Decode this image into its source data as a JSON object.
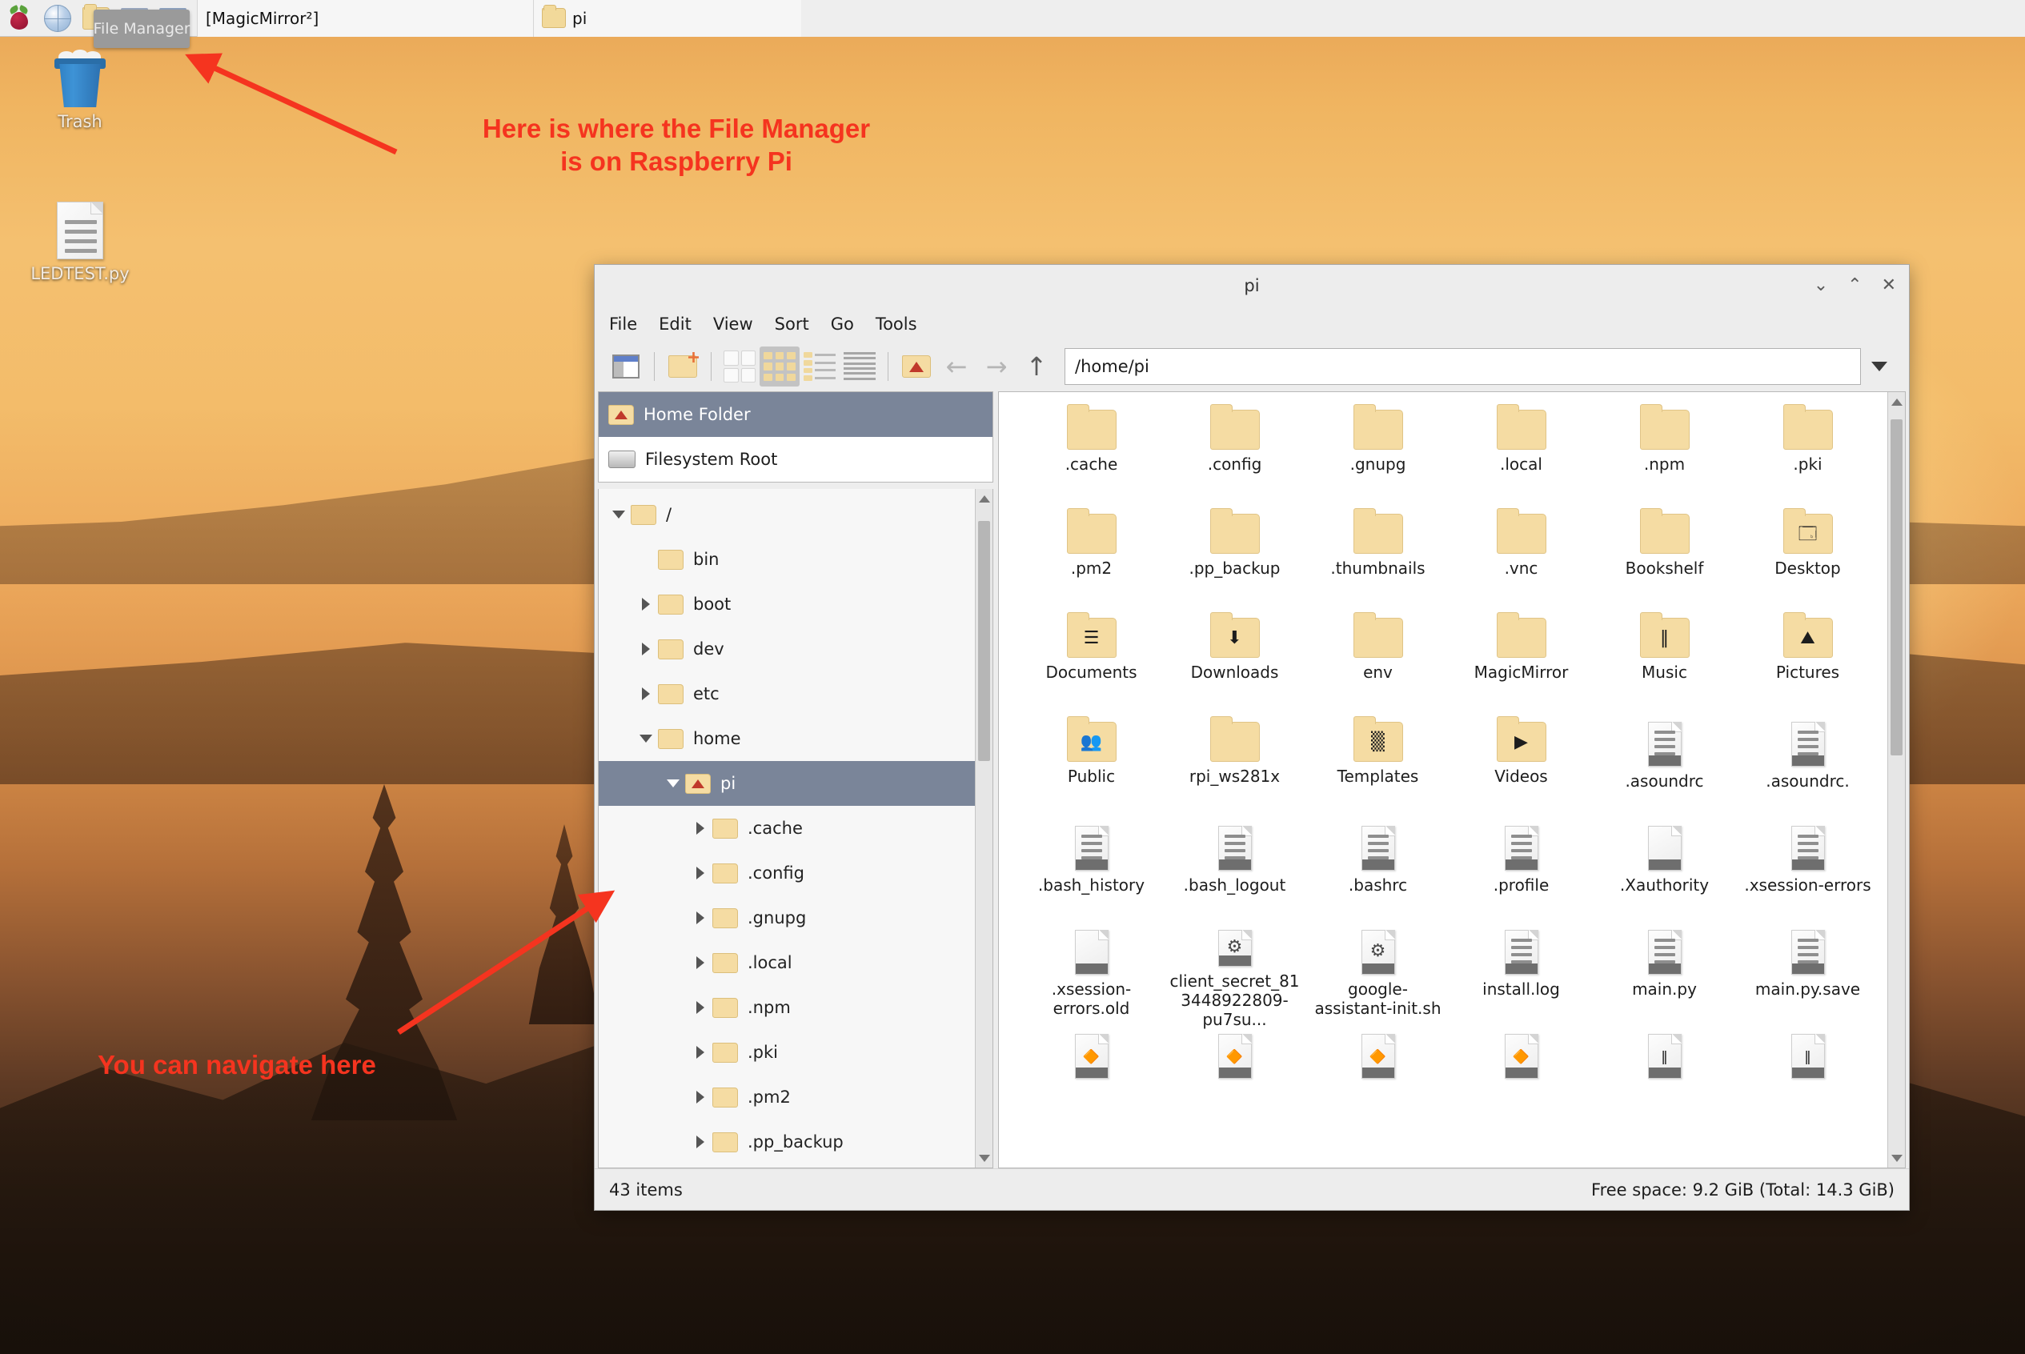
{
  "taskbar": {
    "launchers": [
      {
        "name": "raspberry-menu",
        "icon": "raspberry-icon"
      },
      {
        "name": "web-browser",
        "icon": "globe-icon"
      },
      {
        "name": "file-manager",
        "icon": "folder-icon"
      },
      {
        "name": "terminal",
        "icon": "monitor-icon"
      },
      {
        "name": "mathematica",
        "icon": "monitor-icon"
      }
    ],
    "windows": [
      {
        "label": "[MagicMirror²]",
        "icon": "monitor-icon",
        "active": false
      },
      {
        "label": "pi",
        "icon": "folder-icon",
        "active": false
      }
    ],
    "tooltip": "File Manager"
  },
  "desktop": {
    "icons": [
      {
        "label": "Trash",
        "icon": "trash-icon"
      },
      {
        "label": "LEDTEST.py",
        "icon": "file-icon"
      }
    ],
    "annotations": [
      {
        "id": "anno-file-manager",
        "line1": "Here is where the File Manager",
        "line2": "is on Raspberry Pi",
        "color": "#f5341f"
      },
      {
        "id": "anno-navigate",
        "line1": "You can navigate here",
        "color": "#f5341f"
      }
    ]
  },
  "window": {
    "title": "pi",
    "controls": {
      "minimize": "⌄",
      "maximize": "⌃",
      "close": "✕"
    },
    "menu": [
      "File",
      "Edit",
      "View",
      "Sort",
      "Go",
      "Tools"
    ],
    "toolbar": {
      "new_tab": "new-tab-icon",
      "new_folder": "new-folder-icon",
      "thumbnail_view": "thumbnail-view-icon",
      "icon_view": "icon-view-icon",
      "compact_view": "compact-view-icon",
      "detailed_view": "detailed-list-view-icon",
      "home": "home-folder-icon",
      "back": "back-arrow-icon",
      "forward": "forward-arrow-icon",
      "up": "up-arrow-icon",
      "dropdown": "path-dropdown-icon"
    },
    "path": "/home/pi",
    "places": [
      {
        "label": "Home Folder",
        "icon": "home-folder-icon",
        "selected": true
      },
      {
        "label": "Filesystem Root",
        "icon": "harddisk-icon",
        "selected": false
      }
    ],
    "tree": [
      {
        "label": "/",
        "depth": 0,
        "twisty": "down",
        "icon": "folder-icon",
        "selected": false
      },
      {
        "label": "bin",
        "depth": 1,
        "twisty": "none",
        "icon": "folder-icon",
        "selected": false
      },
      {
        "label": "boot",
        "depth": 1,
        "twisty": "right",
        "icon": "folder-icon",
        "selected": false
      },
      {
        "label": "dev",
        "depth": 1,
        "twisty": "right",
        "icon": "folder-icon",
        "selected": false
      },
      {
        "label": "etc",
        "depth": 1,
        "twisty": "right",
        "icon": "folder-icon",
        "selected": false
      },
      {
        "label": "home",
        "depth": 1,
        "twisty": "down",
        "icon": "folder-icon",
        "selected": false
      },
      {
        "label": "pi",
        "depth": 2,
        "twisty": "down",
        "icon": "home-folder-icon",
        "selected": true
      },
      {
        "label": ".cache",
        "depth": 3,
        "twisty": "right",
        "icon": "folder-icon",
        "selected": false
      },
      {
        "label": ".config",
        "depth": 3,
        "twisty": "right",
        "icon": "folder-icon",
        "selected": false
      },
      {
        "label": ".gnupg",
        "depth": 3,
        "twisty": "right",
        "icon": "folder-icon",
        "selected": false
      },
      {
        "label": ".local",
        "depth": 3,
        "twisty": "right",
        "icon": "folder-icon",
        "selected": false
      },
      {
        "label": ".npm",
        "depth": 3,
        "twisty": "right",
        "icon": "folder-icon",
        "selected": false
      },
      {
        "label": ".pki",
        "depth": 3,
        "twisty": "right",
        "icon": "folder-icon",
        "selected": false
      },
      {
        "label": ".pm2",
        "depth": 3,
        "twisty": "right",
        "icon": "folder-icon",
        "selected": false
      },
      {
        "label": ".pp_backup",
        "depth": 3,
        "twisty": "right",
        "icon": "folder-icon",
        "selected": false
      }
    ],
    "files": [
      {
        "name": ".cache",
        "type": "folder",
        "emblem": ""
      },
      {
        "name": ".config",
        "type": "folder",
        "emblem": ""
      },
      {
        "name": ".gnupg",
        "type": "folder",
        "emblem": ""
      },
      {
        "name": ".local",
        "type": "folder",
        "emblem": ""
      },
      {
        "name": ".npm",
        "type": "folder",
        "emblem": ""
      },
      {
        "name": ".pki",
        "type": "folder",
        "emblem": ""
      },
      {
        "name": ".pm2",
        "type": "folder",
        "emblem": ""
      },
      {
        "name": ".pp_backup",
        "type": "folder",
        "emblem": ""
      },
      {
        "name": ".thumbnails",
        "type": "folder",
        "emblem": ""
      },
      {
        "name": ".vnc",
        "type": "folder",
        "emblem": ""
      },
      {
        "name": "Bookshelf",
        "type": "folder",
        "emblem": ""
      },
      {
        "name": "Desktop",
        "type": "folder",
        "emblem": "🗔"
      },
      {
        "name": "Documents",
        "type": "folder",
        "emblem": "☰"
      },
      {
        "name": "Downloads",
        "type": "folder",
        "emblem": "⬇"
      },
      {
        "name": "env",
        "type": "folder",
        "emblem": ""
      },
      {
        "name": "MagicMirror",
        "type": "folder",
        "emblem": ""
      },
      {
        "name": "Music",
        "type": "folder",
        "emblem": "‖"
      },
      {
        "name": "Pictures",
        "type": "folder",
        "emblem": "⛰"
      },
      {
        "name": "Public",
        "type": "folder",
        "emblem": "👥"
      },
      {
        "name": "rpi_ws281x",
        "type": "folder",
        "emblem": ""
      },
      {
        "name": "Templates",
        "type": "folder",
        "emblem": "▒"
      },
      {
        "name": "Videos",
        "type": "folder",
        "emblem": "▶"
      },
      {
        "name": ".asoundrc",
        "type": "text",
        "emblem": ""
      },
      {
        "name": ".asoundrc.",
        "type": "text",
        "emblem": ""
      },
      {
        "name": ".bash_history",
        "type": "text",
        "emblem": ""
      },
      {
        "name": ".bash_logout",
        "type": "text",
        "emblem": ""
      },
      {
        "name": ".bashrc",
        "type": "text",
        "emblem": ""
      },
      {
        "name": ".profile",
        "type": "text",
        "emblem": ""
      },
      {
        "name": ".Xauthority",
        "type": "blank",
        "emblem": ""
      },
      {
        "name": ".xsession-errors",
        "type": "text",
        "emblem": ""
      },
      {
        "name": ".xsession-errors.old",
        "type": "blank",
        "emblem": ""
      },
      {
        "name": "client_secret_813448922809-pu7su...",
        "type": "gear",
        "emblem": "⚙"
      },
      {
        "name": "google-assistant-init.sh",
        "type": "gear",
        "emblem": "⚙"
      },
      {
        "name": "install.log",
        "type": "text",
        "emblem": ""
      },
      {
        "name": "main.py",
        "type": "text",
        "emblem": ""
      },
      {
        "name": "main.py.save",
        "type": "text",
        "emblem": ""
      },
      {
        "name": "",
        "type": "py",
        "emblem": "🔶"
      },
      {
        "name": "",
        "type": "py",
        "emblem": "🔶"
      },
      {
        "name": "",
        "type": "py",
        "emblem": "🔶"
      },
      {
        "name": "",
        "type": "py",
        "emblem": "🔶"
      },
      {
        "name": "",
        "type": "py",
        "emblem": "‖"
      },
      {
        "name": "",
        "type": "py",
        "emblem": "‖"
      }
    ],
    "status": {
      "items": "43 items",
      "free_space": "Free space: 9.2 GiB (Total: 14.3 GiB)"
    }
  }
}
